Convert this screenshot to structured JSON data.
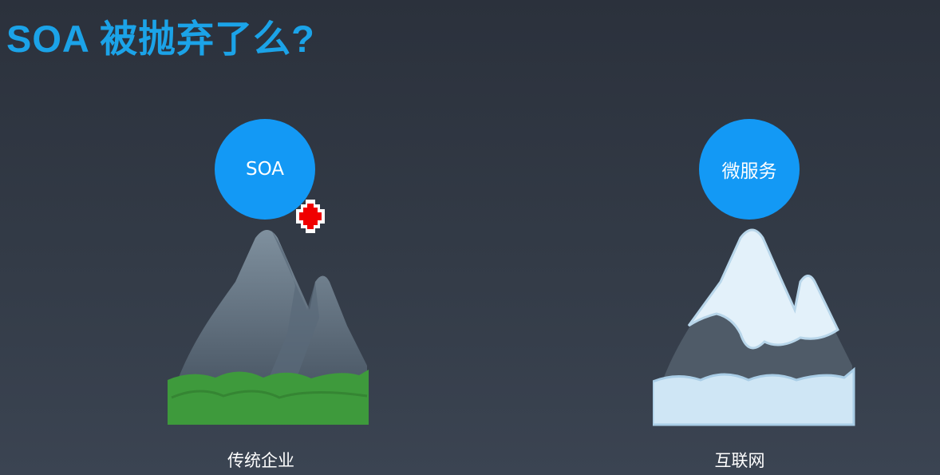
{
  "title": "SOA 被抛弃了么?",
  "left": {
    "badge": "SOA",
    "caption": "传统企业"
  },
  "right": {
    "badge": "微服务",
    "caption": "互联网"
  },
  "colors": {
    "accent": "#1399f5",
    "title": "#1ba3e8",
    "grass": "#3e9a3c",
    "snow": "#d8ecf7"
  }
}
